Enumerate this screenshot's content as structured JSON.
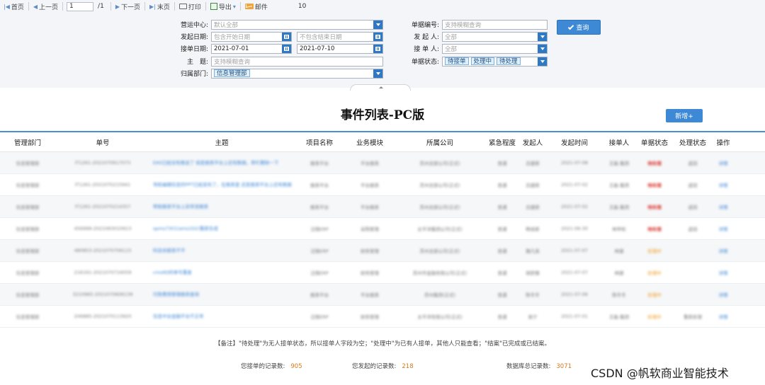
{
  "toolbar": {
    "first": "首页",
    "prev": "上一页",
    "page": "1",
    "total_pages": "/1",
    "next": "下一页",
    "last": "末页",
    "print": "打印",
    "export": "导出",
    "mail": "邮件",
    "page_size": "10"
  },
  "filters": {
    "yunying_label": "营运中心:",
    "yunying_value": "默认全部",
    "start_date_label": "发起日期:",
    "start_from_ph": "包含开始日期",
    "start_to_ph": "不包含结束日期",
    "accept_date_label": "接单日期:",
    "accept_from": "2021-07-01",
    "accept_to": "2021-07-10",
    "subject_label": "主　题:",
    "subject_ph": "支持模糊查询",
    "dept_label": "归属部门:",
    "dept_chip": "信息管理部",
    "number_label": "单据编号:",
    "number_ph": "支持模糊查询",
    "initiator_label": "发 起 人:",
    "initiator_value": "全部",
    "acceptor_label": "接 单 人:",
    "acceptor_value": "全部",
    "status_label": "单据状态:",
    "status_chips": [
      "待接单",
      "处理中",
      "待处理"
    ],
    "search_button": "查询"
  },
  "page_title": "事件列表-PC版",
  "add_button": "新增+",
  "table": {
    "headers": [
      "管理部门",
      "单号",
      "主题",
      "项目名称",
      "业务模块",
      "所属公司",
      "紧急程度",
      "发起人",
      "发起时间",
      "接单人",
      "单据状态",
      "处理状态",
      "操作"
    ],
    "rows": [
      [
        "信息管理部",
        "IT1261-2021070617073",
        "EAS已经没有推送了 但是报表平台上还有数据，帮忙删除一下",
        "报表平台",
        "平台报表",
        "苏州总部公司(正式)",
        "普通",
        "吕建新",
        "2021-07-08",
        "王磊-集团",
        "待处理",
        "返回",
        "详情"
      ],
      [
        "信息管理部",
        "IT1261-2021070215941",
        "导航编辑信息的PPT已经发布了，在报表里 还是报表平台上还有数据",
        "报表平台",
        "平台报表",
        "苏州总部公司(正式)",
        "普通",
        "吕建新",
        "2021-07-02",
        "王磊-集团",
        "待处理",
        "返回",
        "详情"
      ],
      [
        "信息管理部",
        "IT1261-2021070214357",
        "帮助报表平台上异常该报表",
        "报表平台",
        "平台报表",
        "苏州总部公司(正式)",
        "普通",
        "吕建新",
        "2021-07-02",
        "王磊-集团",
        "待处理",
        "返回",
        "详情"
      ],
      [
        "信息管理部",
        "456999-2021063010913",
        "spms7301(ams1D2)重新生成",
        "泛微ERP",
        "采购管理",
        "太平洋集团公司(正式)",
        "普通",
        "韩佳新",
        "2021-06-30",
        "林亭松",
        "待处理",
        "返回",
        "详情"
      ],
      [
        "信息管理部",
        "480853-2021070706115",
        "科目余额表不平",
        "泛微ERP",
        "财务管理",
        "苏州总部公司(正式)",
        "普通",
        "魏凡英",
        "2021-07-07",
        "林捷",
        "处理中",
        "",
        "详情"
      ],
      [
        "信息管理部",
        "216161-2021070716059",
        "cms9D的单号重复",
        "泛微ERP",
        "财务管理",
        "苏州市金融有限公司(正式)",
        "普通",
        "胡舒雅",
        "2021-07-07",
        "林捷",
        "处理中",
        "",
        "详情"
      ],
      [
        "信息管理部",
        "3210965-2021070606139",
        "付款费用管理报表查询",
        "报表平台",
        "平台报表",
        "苏州集团(正式)",
        "普通",
        "陈冬冬",
        "2021-07-06",
        "陈冬冬",
        "处理中",
        "",
        "详情"
      ],
      [
        "信息管理部",
        "206885-2021070113920",
        "信息中台金融平台不正常",
        "泛微ERP",
        "财务管理",
        "太平洋有限公司(正式)",
        "普通",
        "吴宁",
        "2021-07-01",
        "王磊-集团",
        "处理中",
        "重新处理",
        "详情"
      ]
    ]
  },
  "note": "【备注】\"待处理\"为无人接单状态，所以接单人字段为空；\"处理中\"为已有人接单，其他人只能查看；\"结案\"已完成或已结案。",
  "stats": {
    "my_received_label": "您接单的记录数:",
    "my_received": "905",
    "my_initiated_label": "您发起的记录数:",
    "my_initiated": "218",
    "db_total_label": "数据库总记录数:",
    "db_total": "3071"
  },
  "watermark": "CSDN @帆软商业智能技术"
}
